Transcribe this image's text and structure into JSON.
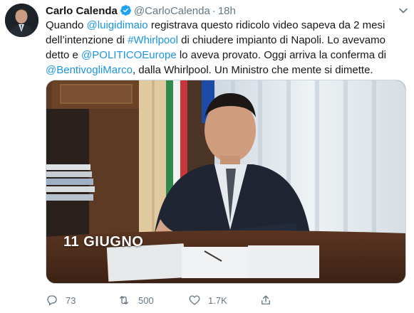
{
  "author": {
    "name": "Carlo Calenda",
    "handle": "@CarloCalenda",
    "separator": "·",
    "time": "18h"
  },
  "tweet": {
    "parts": [
      {
        "text": "Quando ",
        "link": false
      },
      {
        "text": "@luigidimaio",
        "link": true
      },
      {
        "text": " registrava questo ridicolo video sapeva da 2 mesi dell’intenzione di ",
        "link": false
      },
      {
        "text": "#Whirlpool",
        "link": true
      },
      {
        "text": " di chiudere impianto di Napoli. Lo avevamo detto e ",
        "link": false
      },
      {
        "text": "@POLITICOEurope",
        "link": true
      },
      {
        "text": " lo aveva provato. Oggi arriva la conferma di ",
        "link": false
      },
      {
        "text": "@BentivogliMarco",
        "link": true
      },
      {
        "text": ", dalla Whirlpool. Un Ministro che mente si dimette.",
        "link": false
      }
    ]
  },
  "media": {
    "caption": "11 GIUGNO"
  },
  "actions": {
    "reply_count": "73",
    "retweet_count": "500",
    "like_count": "1.7K"
  },
  "icons": {
    "verified": "verified-badge-icon",
    "chevron": "chevron-down-icon",
    "reply": "reply-icon",
    "retweet": "retweet-icon",
    "like": "heart-icon",
    "share": "share-icon"
  },
  "colors": {
    "link": "#1b95e0",
    "secondary": "#657786",
    "text": "#14171a"
  }
}
